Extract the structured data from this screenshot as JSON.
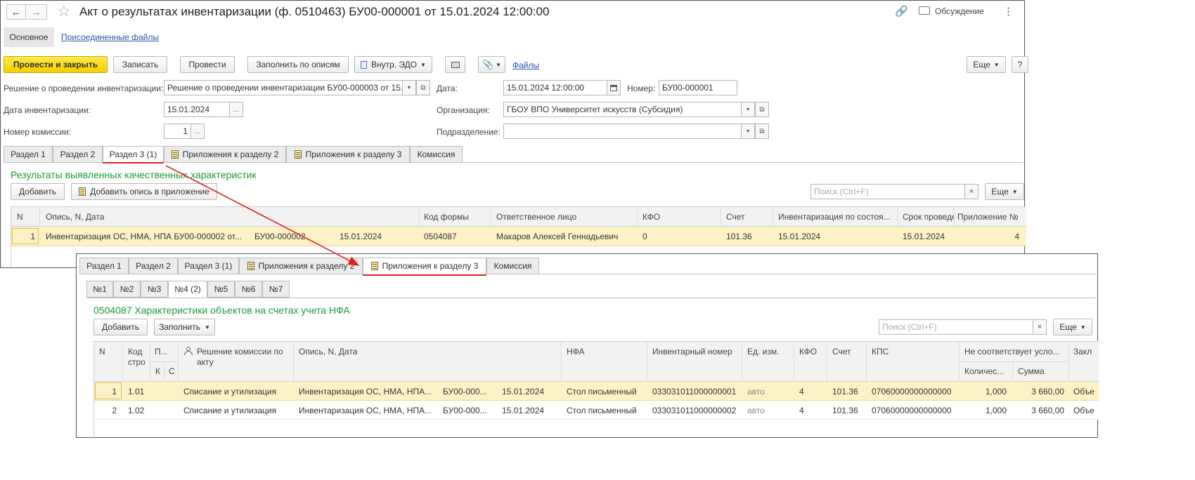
{
  "main_window": {
    "title": "Акт о результатах инвентаризации (ф. 0510463) БУ00-000001 от 15.01.2024 12:00:00",
    "discuss_label": "Обсуждение",
    "nav": {
      "main": "Основное",
      "files": "Присоединенные файлы"
    },
    "toolbar": {
      "post_close": "Провести и закрыть",
      "save": "Записать",
      "post": "Провести",
      "fill_by_lists": "Заполнить по описям",
      "edo": "Внутр. ЭДО",
      "files_link": "Файлы",
      "more": "Еще",
      "help": "?"
    },
    "form": {
      "decision_label": "Решение о проведении инвентаризации:",
      "decision_value": "Решение о проведении инвентаризации БУ00-000003 от 15.0",
      "date_label": "Дата:",
      "date_value": "15.01.2024 12:00:00",
      "number_label": "Номер:",
      "number_value": "БУ00-000001",
      "inv_date_label": "Дата инвентаризации:",
      "inv_date_value": "15.01.2024",
      "org_label": "Организация:",
      "org_value": "ГБОУ ВПО Университет искусств (Субсидия)",
      "commission_label": "Номер комиссии:",
      "commission_value": "1",
      "division_label": "Подразделение:",
      "division_value": ""
    },
    "tabs": [
      "Раздел 1",
      "Раздел 2",
      "Раздел 3 (1)",
      "Приложения к разделу 2",
      "Приложения к разделу 3",
      "Комиссия"
    ],
    "active_tab": "Раздел 3 (1)",
    "section_title": "Результаты выявленных качественных характеристик",
    "section_toolbar": {
      "add": "Добавить",
      "add_list": "Добавить опись в приложение",
      "search_placeholder": "Поиск (Ctrl+F)",
      "more": "Еще"
    },
    "table": {
      "headers": [
        "N",
        "Опись, N, Дата",
        "Код формы",
        "Ответственное лицо",
        "КФО",
        "Счет",
        "Инвентаризация по состоя...",
        "Срок проведе...",
        "Приложение №"
      ],
      "rows": [
        {
          "n": "1",
          "list": "Инвентаризация ОС, НМА, НПА БУ00-000002 от...",
          "list_num": "БУ00-000002",
          "list_date": "15.01.2024",
          "form_code": "0504087",
          "person": "Макаров Алексей Геннадьевич",
          "kfo": "0",
          "account": "101.36",
          "inv_state": "15.01.2024",
          "deadline": "15.01.2024",
          "app_num": "4"
        }
      ]
    }
  },
  "overlay_window": {
    "tabs": [
      "Раздел 1",
      "Раздел 2",
      "Раздел 3 (1)",
      "Приложения к разделу 2",
      "Приложения к разделу 3",
      "Комиссия"
    ],
    "active_tab": "Приложения к разделу 3",
    "subtabs": [
      "№1",
      "№2",
      "№3",
      "№4 (2)",
      "№5",
      "№6",
      "№7"
    ],
    "active_subtab": "№4 (2)",
    "section_title": "0504087 Характеристики объектов на счетах учета НФА",
    "toolbar": {
      "add": "Добавить",
      "fill": "Заполнить",
      "search_placeholder": "Поиск (Ctrl+F)",
      "more": "Еще"
    },
    "table": {
      "headers": {
        "n": "N",
        "code": "Код стро",
        "p": "П...",
        "k": "К",
        "s": "С",
        "decision": "Решение комиссии по акту",
        "list": "Опись, N, Дата",
        "nfa": "НФА",
        "inv_number": "Инвентарный номер",
        "unit": "Ед. изм.",
        "kfo": "КФО",
        "account": "Счет",
        "kps": "КПС",
        "mismatch": "Не соответствует усло...",
        "qty": "Количес...",
        "sum": "Сумма",
        "conclusion": "Закл"
      },
      "rows": [
        {
          "n": "1",
          "code": "1.01",
          "decision": "Списание и утилизация",
          "list": "Инвентаризация ОС, НМА, НПА...",
          "list_num": "БУ00-000...",
          "list_date": "15.01.2024",
          "nfa": "Стол письменный",
          "inv_number": "033031011000000001",
          "unit": "авто",
          "kfo": "4",
          "account": "101.36",
          "kps": "07060000000000000",
          "qty": "1,000",
          "sum": "3 660,00",
          "conclusion": "Объе"
        },
        {
          "n": "2",
          "code": "1.02",
          "decision": "Списание и утилизация",
          "list": "Инвентаризация ОС, НМА, НПА...",
          "list_num": "БУ00-000...",
          "list_date": "15.01.2024",
          "nfa": "Стол письменный",
          "inv_number": "033031011000000002",
          "unit": "авто",
          "kfo": "4",
          "account": "101.36",
          "kps": "07060000000000000",
          "qty": "1,000",
          "sum": "3 660,00",
          "conclusion": "Объе"
        }
      ]
    }
  },
  "colors": {
    "accent_yellow": "#f5cf00",
    "selected_row": "#fdf2c6",
    "section_title": "#1a9a3a",
    "link": "#2755a8",
    "arrow": "#e02020"
  }
}
